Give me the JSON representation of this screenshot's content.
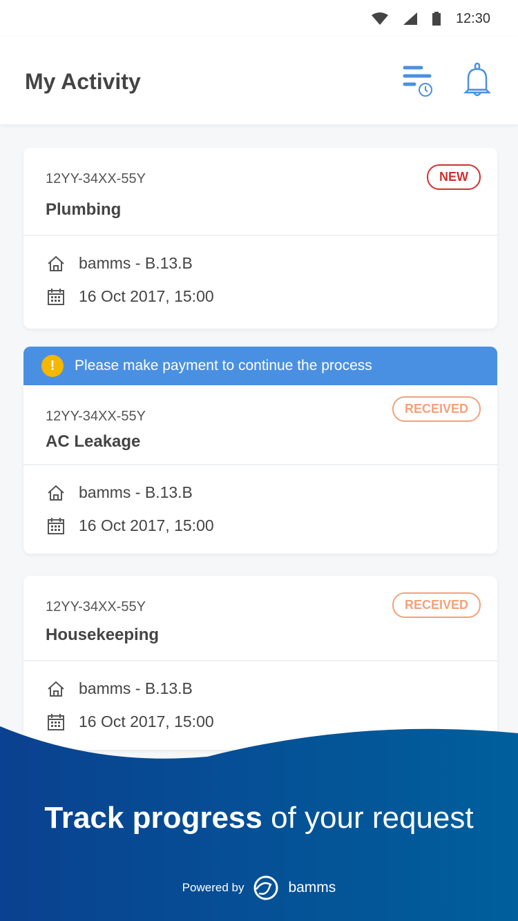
{
  "status_bar": {
    "time": "12:30"
  },
  "header": {
    "title": "My Activity"
  },
  "banner": {
    "text": "Please make payment to continue the process"
  },
  "cards": [
    {
      "code": "12YY-34XX-55Y",
      "name": "Plumbing",
      "status": "NEW",
      "status_color": "#d0312d",
      "location": "bamms - B.13.B",
      "datetime": "16 Oct 2017, 15:00"
    },
    {
      "code": "12YY-34XX-55Y",
      "name": "AC Leakage",
      "status": "RECEIVED",
      "status_color": "#f5a07a",
      "location": "bamms - B.13.B",
      "datetime": "16 Oct 2017, 15:00"
    },
    {
      "code": "12YY-34XX-55Y",
      "name": "Housekeeping",
      "status": "RECEIVED",
      "status_color": "#f5a07a",
      "location": "bamms - B.13.B",
      "datetime": "16 Oct 2017, 15:00"
    }
  ],
  "footer": {
    "tagline_bold": "Track progress",
    "tagline_rest": " of your request",
    "powered_by": "Powered by",
    "brand": "bamms"
  },
  "colors": {
    "accent": "#4a90e2",
    "footer": "#0a4a94"
  }
}
